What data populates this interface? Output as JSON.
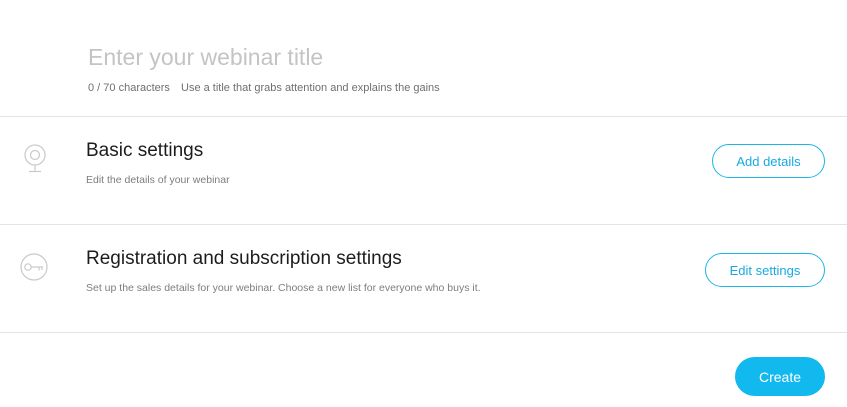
{
  "title_section": {
    "input_value": "",
    "input_placeholder": "Enter your webinar title",
    "char_count": "0 / 70 characters",
    "hint": "Use a title that grabs attention and explains the gains"
  },
  "basic_settings": {
    "icon": "webcam-icon",
    "heading": "Basic settings",
    "description": "Edit the details of your webinar",
    "button_label": "Add details"
  },
  "registration_settings": {
    "icon": "key-icon",
    "heading": "Registration and subscription settings",
    "description": "Set up the sales details for your webinar. Choose a new list for everyone who buys it.",
    "button_label": "Edit settings"
  },
  "footer": {
    "create_label": "Create"
  },
  "colors": {
    "accent": "#12b9ef",
    "outline_button_border": "#1cb5e8",
    "divider": "#e3e3e3",
    "placeholder": "#c4c4c4"
  }
}
